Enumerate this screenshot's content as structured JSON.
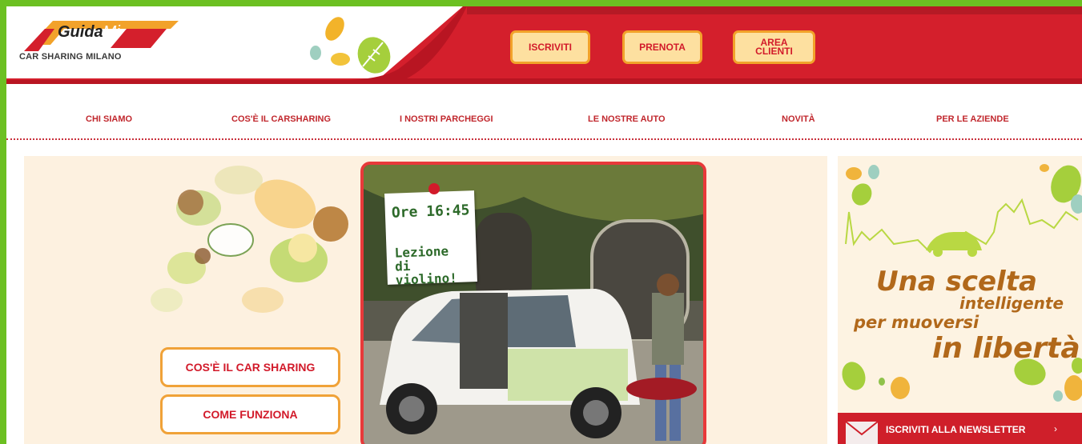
{
  "logo": {
    "brand_a": "Guida",
    "brand_b": "Mi",
    "subtitle": "CAR SHARING MILANO"
  },
  "header_buttons": {
    "signup": "ISCRIVITI",
    "book": "PRENOTA",
    "area_line1": "AREA",
    "area_line2": "CLIENTI"
  },
  "nav": {
    "items": [
      "CHI SIAMO",
      "COS'È IL CARSHARING",
      "I NOSTRI PARCHEGGI",
      "LE NOSTRE AUTO",
      "NOVITÀ",
      "PER LE AZIENDE"
    ]
  },
  "main": {
    "cta_what": "COS'È IL CAR SHARING",
    "cta_how": "COME FUNZIONA",
    "note_time": "Ore 16:45",
    "note_line1": "Lezione",
    "note_line2": "di violino!"
  },
  "ad": {
    "line1": "Una scelta",
    "line2": "intelligente",
    "line3": "per muoversi",
    "line4": "in libertà",
    "newsletter": "ISCRIVITI ALLA NEWSLETTER",
    "arrow": "›"
  },
  "colors": {
    "brand_red": "#d21a2a",
    "frame_green": "#6cc022",
    "accent_orange": "#f2a22a"
  }
}
